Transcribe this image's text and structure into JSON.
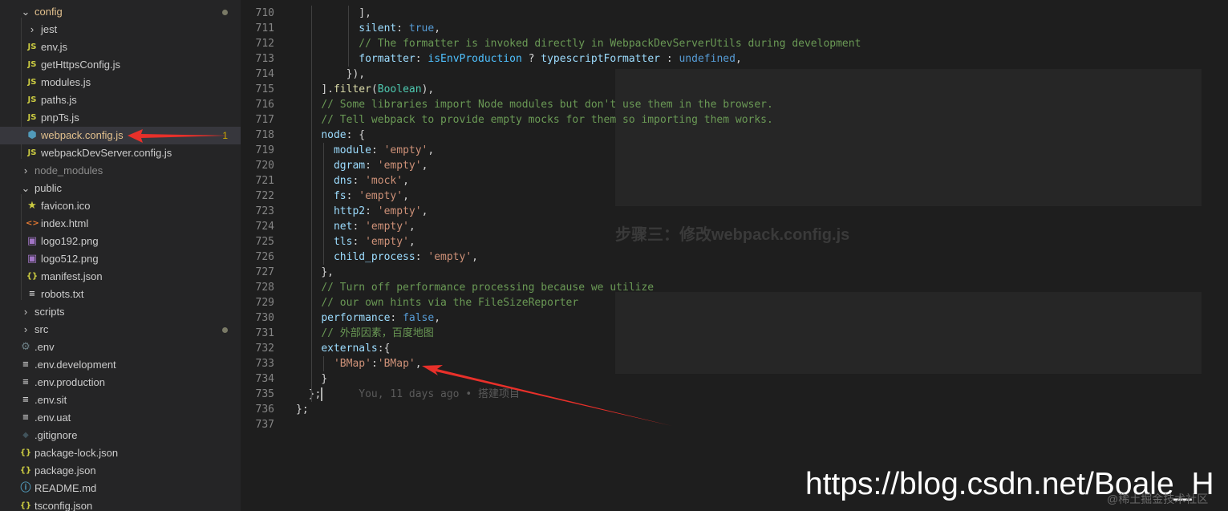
{
  "explorer": {
    "items": [
      {
        "label": "config",
        "type": "folder-open",
        "icon": "chevron-down-icon",
        "color": "#e2c08d"
      },
      {
        "label": "jest",
        "type": "folder",
        "icon": "chevron-right-icon"
      },
      {
        "label": "env.js",
        "type": "js",
        "icon": "js-file-icon"
      },
      {
        "label": "getHttpsConfig.js",
        "type": "js",
        "icon": "js-file-icon"
      },
      {
        "label": "modules.js",
        "type": "js",
        "icon": "js-file-icon"
      },
      {
        "label": "paths.js",
        "type": "js",
        "icon": "js-file-icon"
      },
      {
        "label": "pnpTs.js",
        "type": "js",
        "icon": "js-file-icon"
      },
      {
        "label": "webpack.config.js",
        "type": "webpack",
        "icon": "webpack-file-icon",
        "color": "#e2c08d",
        "badge": "1"
      },
      {
        "label": "webpackDevServer.config.js",
        "type": "js",
        "icon": "js-file-icon"
      },
      {
        "label": "node_modules",
        "type": "folder",
        "icon": "chevron-right-icon",
        "color": "#8c8c8c"
      },
      {
        "label": "public",
        "type": "folder-open",
        "icon": "chevron-down-icon"
      },
      {
        "label": "favicon.ico",
        "type": "ico",
        "icon": "star-icon"
      },
      {
        "label": "index.html",
        "type": "html",
        "icon": "html-file-icon"
      },
      {
        "label": "logo192.png",
        "type": "img",
        "icon": "image-file-icon"
      },
      {
        "label": "logo512.png",
        "type": "img",
        "icon": "image-file-icon"
      },
      {
        "label": "manifest.json",
        "type": "json",
        "icon": "json-file-icon"
      },
      {
        "label": "robots.txt",
        "type": "txt",
        "icon": "text-file-icon"
      },
      {
        "label": "scripts",
        "type": "folder",
        "icon": "chevron-right-icon"
      },
      {
        "label": "src",
        "type": "folder",
        "icon": "chevron-right-icon"
      },
      {
        "label": ".env",
        "type": "gear",
        "icon": "gear-icon"
      },
      {
        "label": ".env.development",
        "type": "txt",
        "icon": "text-file-icon"
      },
      {
        "label": ".env.production",
        "type": "txt",
        "icon": "text-file-icon"
      },
      {
        "label": ".env.sit",
        "type": "txt",
        "icon": "text-file-icon"
      },
      {
        "label": ".env.uat",
        "type": "txt",
        "icon": "text-file-icon"
      },
      {
        "label": ".gitignore",
        "type": "git",
        "icon": "git-icon"
      },
      {
        "label": "package-lock.json",
        "type": "json",
        "icon": "json-file-icon"
      },
      {
        "label": "package.json",
        "type": "json",
        "icon": "json-file-icon"
      },
      {
        "label": "README.md",
        "type": "info",
        "icon": "info-icon"
      },
      {
        "label": "tsconfig.json",
        "type": "json",
        "icon": "json-file-icon"
      }
    ]
  },
  "editor": {
    "lines": [
      {
        "n": "710",
        "indent": 10,
        "tokens": [
          [
            "t-punc",
            "],"
          ]
        ]
      },
      {
        "n": "711",
        "indent": 10,
        "tokens": [
          [
            "t-prop",
            "silent"
          ],
          [
            "t-punc",
            ": "
          ],
          [
            "t-kw",
            "true"
          ],
          [
            "t-punc",
            ","
          ]
        ]
      },
      {
        "n": "712",
        "indent": 10,
        "tokens": [
          [
            "t-cm",
            "// The formatter is invoked directly in WebpackDevServerUtils during development"
          ]
        ]
      },
      {
        "n": "713",
        "indent": 10,
        "tokens": [
          [
            "t-prop",
            "formatter"
          ],
          [
            "t-punc",
            ": "
          ],
          [
            "t-var",
            "isEnvProduction"
          ],
          [
            "t-punc",
            " ? "
          ],
          [
            "t-prop",
            "typescriptFormatter"
          ],
          [
            "t-punc",
            " : "
          ],
          [
            "t-kw",
            "undefined"
          ],
          [
            "t-punc",
            ","
          ]
        ]
      },
      {
        "n": "714",
        "indent": 8,
        "tokens": [
          [
            "t-punc",
            "}),"
          ]
        ]
      },
      {
        "n": "715",
        "indent": 4,
        "tokens": [
          [
            "t-punc",
            "]."
          ],
          [
            "t-fn",
            "filter"
          ],
          [
            "t-punc",
            "("
          ],
          [
            "t-cls",
            "Boolean"
          ],
          [
            "t-punc",
            "),"
          ]
        ]
      },
      {
        "n": "716",
        "indent": 4,
        "tokens": [
          [
            "t-cm",
            "// Some libraries import Node modules but don't use them in the browser."
          ]
        ]
      },
      {
        "n": "717",
        "indent": 4,
        "tokens": [
          [
            "t-cm",
            "// Tell webpack to provide empty mocks for them so importing them works."
          ]
        ]
      },
      {
        "n": "718",
        "indent": 4,
        "tokens": [
          [
            "t-prop",
            "node"
          ],
          [
            "t-punc",
            ": {"
          ]
        ]
      },
      {
        "n": "719",
        "indent": 6,
        "tokens": [
          [
            "t-prop",
            "module"
          ],
          [
            "t-punc",
            ": "
          ],
          [
            "t-str",
            "'empty'"
          ],
          [
            "t-punc",
            ","
          ]
        ]
      },
      {
        "n": "720",
        "indent": 6,
        "tokens": [
          [
            "t-prop",
            "dgram"
          ],
          [
            "t-punc",
            ": "
          ],
          [
            "t-str",
            "'empty'"
          ],
          [
            "t-punc",
            ","
          ]
        ]
      },
      {
        "n": "721",
        "indent": 6,
        "tokens": [
          [
            "t-prop",
            "dns"
          ],
          [
            "t-punc",
            ": "
          ],
          [
            "t-str",
            "'mock'"
          ],
          [
            "t-punc",
            ","
          ]
        ]
      },
      {
        "n": "722",
        "indent": 6,
        "tokens": [
          [
            "t-prop",
            "fs"
          ],
          [
            "t-punc",
            ": "
          ],
          [
            "t-str",
            "'empty'"
          ],
          [
            "t-punc",
            ","
          ]
        ]
      },
      {
        "n": "723",
        "indent": 6,
        "tokens": [
          [
            "t-prop",
            "http2"
          ],
          [
            "t-punc",
            ": "
          ],
          [
            "t-str",
            "'empty'"
          ],
          [
            "t-punc",
            ","
          ]
        ]
      },
      {
        "n": "724",
        "indent": 6,
        "tokens": [
          [
            "t-prop",
            "net"
          ],
          [
            "t-punc",
            ": "
          ],
          [
            "t-str",
            "'empty'"
          ],
          [
            "t-punc",
            ","
          ]
        ]
      },
      {
        "n": "725",
        "indent": 6,
        "tokens": [
          [
            "t-prop",
            "tls"
          ],
          [
            "t-punc",
            ": "
          ],
          [
            "t-str",
            "'empty'"
          ],
          [
            "t-punc",
            ","
          ]
        ]
      },
      {
        "n": "726",
        "indent": 6,
        "tokens": [
          [
            "t-prop",
            "child_process"
          ],
          [
            "t-punc",
            ": "
          ],
          [
            "t-str",
            "'empty'"
          ],
          [
            "t-punc",
            ","
          ]
        ]
      },
      {
        "n": "727",
        "indent": 4,
        "tokens": [
          [
            "t-punc",
            "},"
          ]
        ]
      },
      {
        "n": "728",
        "indent": 4,
        "tokens": [
          [
            "t-cm",
            "// Turn off performance processing because we utilize"
          ]
        ]
      },
      {
        "n": "729",
        "indent": 4,
        "tokens": [
          [
            "t-cm",
            "// our own hints via the FileSizeReporter"
          ]
        ]
      },
      {
        "n": "730",
        "indent": 4,
        "tokens": [
          [
            "t-prop",
            "performance"
          ],
          [
            "t-punc",
            ": "
          ],
          [
            "t-kw",
            "false"
          ],
          [
            "t-punc",
            ","
          ]
        ]
      },
      {
        "n": "731",
        "indent": 4,
        "tokens": [
          [
            "t-cm",
            "// 外部因素，百度地图"
          ]
        ]
      },
      {
        "n": "732",
        "indent": 4,
        "tokens": [
          [
            "t-prop",
            "externals"
          ],
          [
            "t-punc",
            ":{"
          ]
        ]
      },
      {
        "n": "733",
        "indent": 6,
        "tokens": [
          [
            "t-str",
            "'BMap'"
          ],
          [
            "t-punc",
            ":"
          ],
          [
            "t-str",
            "'BMap'"
          ],
          [
            "t-punc",
            ","
          ]
        ]
      },
      {
        "n": "734",
        "indent": 4,
        "tokens": [
          [
            "t-punc",
            "}"
          ]
        ]
      },
      {
        "n": "735",
        "indent": 2,
        "tokens": [
          [
            "t-punc",
            "};"
          ],
          [
            "t-blame",
            "      You, 11 days ago • 搭建项目"
          ]
        ]
      },
      {
        "n": "736",
        "indent": 0,
        "tokens": [
          [
            "t-punc",
            "};"
          ]
        ]
      },
      {
        "n": "737",
        "indent": 0,
        "tokens": []
      }
    ],
    "background_heading": "步骤三：修改webpack.config.js"
  },
  "watermark": {
    "url": "https://blog.csdn.net/Boale_H",
    "sub": "@稀土掘金技术社区"
  },
  "colors": {
    "arrow": "#e8302a"
  }
}
